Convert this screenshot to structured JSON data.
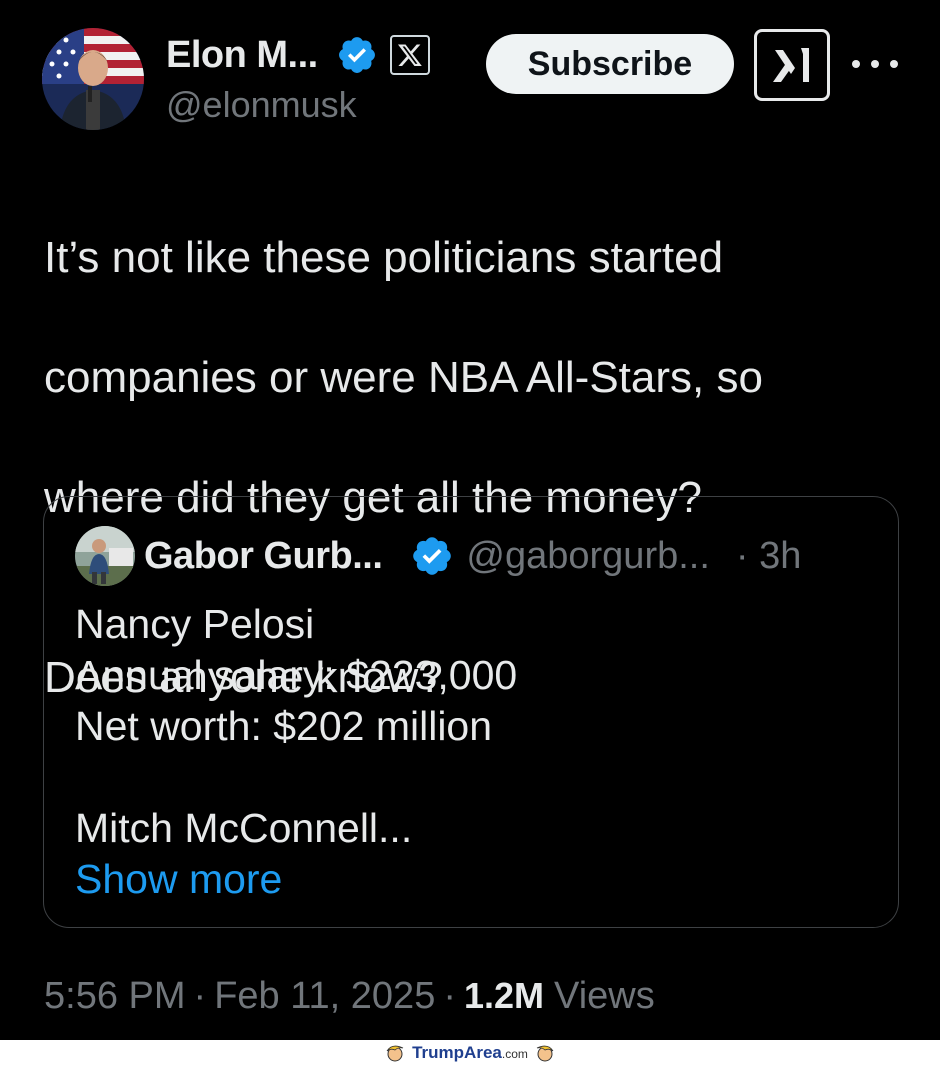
{
  "author": {
    "display_name": "Elon M...",
    "handle": "@elonmusk"
  },
  "header": {
    "subscribe_label": "Subscribe"
  },
  "tweet": {
    "lines": [
      "It’s not like these politicians started",
      "companies or were NBA All-Stars, so",
      "where did they get all the money?"
    ],
    "second_paragraph": "Does anyone know?"
  },
  "quoted": {
    "display_name": "Gabor Gurb...",
    "handle": "@gaborgurb...",
    "time": "· 3h",
    "lines": [
      "Nancy Pelosi",
      "Annual salary: $223,000",
      "Net worth: $202 million"
    ],
    "truncated_line": "Mitch McConnell...",
    "show_more": "Show more"
  },
  "meta": {
    "time": "5:56 PM",
    "date": "Feb 11, 2025",
    "views_count": "1.2M",
    "views_label": "Views"
  },
  "watermark": {
    "name": "TrumpArea",
    "suffix": ".com"
  },
  "colors": {
    "background": "#000000",
    "text": "#e7e9ea",
    "muted": "#71767b",
    "link": "#1d9bf0",
    "verified": "#1d9bf0"
  },
  "icons": [
    "avatar",
    "verified-badge-icon",
    "x-logo-icon",
    "grok-icon",
    "more-icon"
  ]
}
